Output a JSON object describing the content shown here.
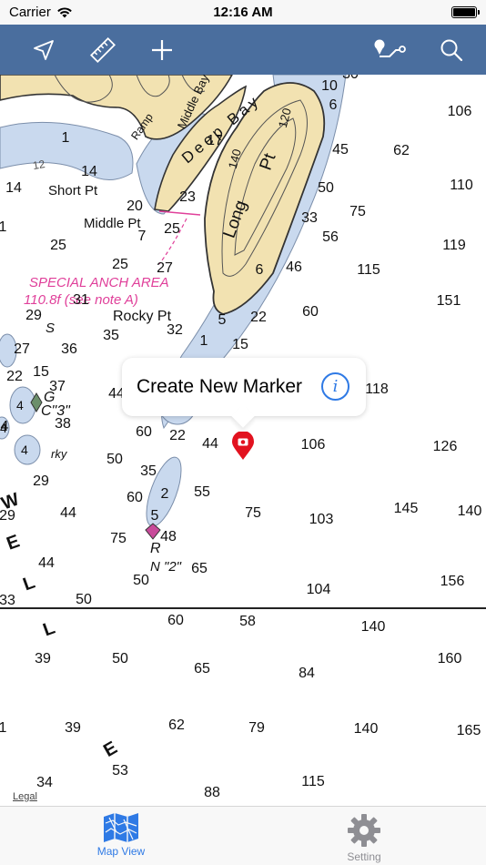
{
  "status_bar": {
    "carrier": "Carrier",
    "time": "12:16 AM"
  },
  "toolbar": {
    "buttons": [
      {
        "name": "navigate-icon"
      },
      {
        "name": "ruler-icon"
      },
      {
        "name": "plus-icon"
      },
      {
        "name": "route-icon"
      },
      {
        "name": "search-icon"
      }
    ],
    "color": "#4a6e9e"
  },
  "map": {
    "depths": [
      "10",
      "106",
      "6",
      "62",
      "45",
      "1",
      "14",
      "17",
      "50",
      "110",
      "14",
      "20",
      "23",
      "33",
      "75",
      "1",
      "7",
      "25",
      "56",
      "119",
      "25",
      "27",
      "115",
      "6",
      "46",
      "151",
      "25",
      "31",
      "32",
      "5",
      "22",
      "60",
      "29",
      "35",
      "1",
      "15",
      "27",
      "36",
      "22",
      "15",
      "37",
      "118",
      "44",
      "38",
      "60",
      "22",
      "44",
      "106",
      "126",
      "4",
      "50",
      "35",
      "29",
      "55",
      "2",
      "60",
      "145",
      "140",
      "29",
      "44",
      "75",
      "103",
      "5",
      "75",
      "48",
      "65",
      "44",
      "156",
      "50",
      "104",
      "33",
      "50",
      "60",
      "58",
      "140",
      "39",
      "50",
      "65",
      "84",
      "160",
      "62",
      "1",
      "39",
      "79",
      "140",
      "165",
      "34",
      "53",
      "88",
      "115",
      "30"
    ],
    "places": {
      "short_pt": "Short Pt",
      "middle_pt": "Middle Pt",
      "rocky_pt": "Rocky Pt",
      "long_pt": "Long",
      "long_pt2": "Pt",
      "deep_bay": "Deep Bay",
      "middle_bay": "Middle Bay",
      "ramp": "Ramp",
      "s_label": "S",
      "g_label": "G",
      "c3_label": "C\"3\"",
      "rky": "rky",
      "r_label": "R",
      "n2_label": "N \"2\"",
      "well_1": "W",
      "well_2": "E",
      "well_3": "L",
      "well_4": "L",
      "well_5": "E",
      "contour_140": "140",
      "contour_120": "120",
      "contour_4a": "4",
      "contour_4b": "4",
      "contour_4c": "4",
      "contour_12": "12"
    },
    "anch_area": {
      "line1": "SPECIAL ANCH AREA",
      "line2": "110.8f  (see note A)"
    },
    "legal": "Legal"
  },
  "callout": {
    "text": "Create New Marker",
    "info": "i"
  },
  "tabbar": {
    "tabs": [
      {
        "label": "Map View",
        "active": true
      },
      {
        "label": "Setting",
        "active": false
      }
    ],
    "active_color": "#2f7ae5",
    "inactive_color": "#8e8e93"
  }
}
